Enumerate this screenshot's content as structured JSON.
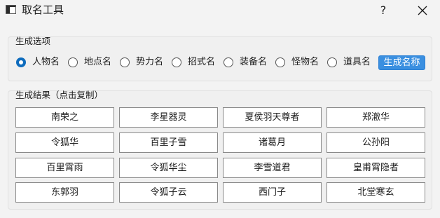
{
  "window": {
    "title": "取名工具",
    "help": "?"
  },
  "options": {
    "group_label": "生成选项",
    "types": [
      {
        "label": "人物名",
        "checked": true
      },
      {
        "label": "地点名",
        "checked": false
      },
      {
        "label": "势力名",
        "checked": false
      },
      {
        "label": "招式名",
        "checked": false
      },
      {
        "label": "装备名",
        "checked": false
      },
      {
        "label": "怪物名",
        "checked": false
      },
      {
        "label": "道具名",
        "checked": false
      }
    ],
    "generate_label": "生成名称"
  },
  "results": {
    "group_label": "生成结果（点击复制）",
    "names": [
      [
        "南荣之",
        "李星器灵",
        "夏侯羽天尊者",
        "郑澈华"
      ],
      [
        "令狐华",
        "百里子雪",
        "诸葛月",
        "公孙阳"
      ],
      [
        "百里霄雨",
        "令狐华尘",
        "李雪道君",
        "皇甫霄隐者"
      ],
      [
        "东郭羽",
        "令狐子云",
        "西门子",
        "北堂寒玄"
      ]
    ]
  },
  "colors": {
    "accent": "#0f6cbd",
    "button_bg": "#3a8fe0"
  }
}
